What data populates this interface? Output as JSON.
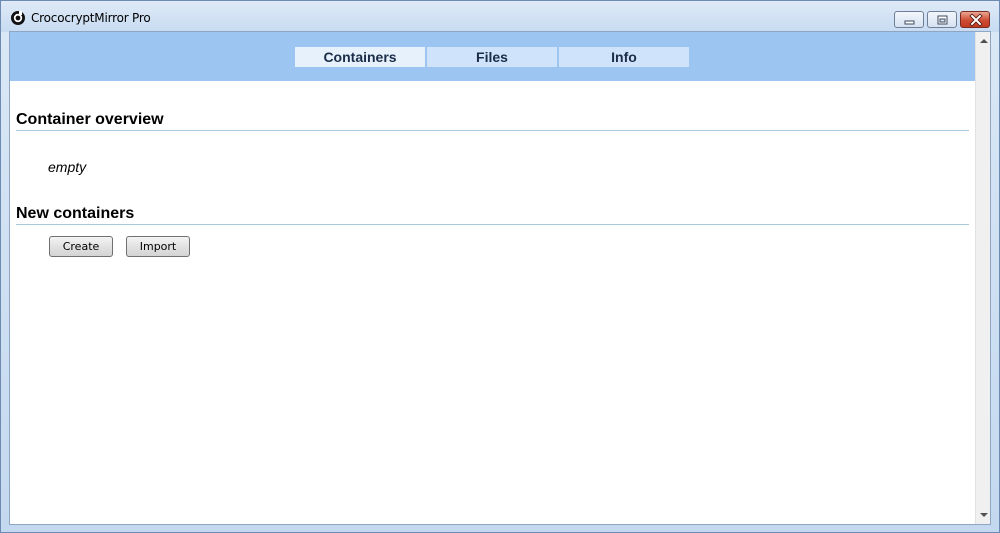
{
  "window": {
    "title": "CrococryptMirror Pro",
    "icon": "crococrypt-logo-icon",
    "controls": [
      "minimize-icon",
      "maximize-icon",
      "close-icon"
    ]
  },
  "nav": {
    "tabs": [
      {
        "label": "Containers",
        "active": true
      },
      {
        "label": "Files",
        "active": false
      },
      {
        "label": "Info",
        "active": false
      }
    ]
  },
  "sections": {
    "overview": {
      "title": "Container overview",
      "empty_text": "empty"
    },
    "new_containers": {
      "title": "New containers",
      "create_label": "Create",
      "import_label": "Import"
    }
  },
  "colors": {
    "nav_band": "#9cc6f1",
    "tab_bg": "#cfe4fa",
    "section_rule": "#a8cbe0"
  }
}
